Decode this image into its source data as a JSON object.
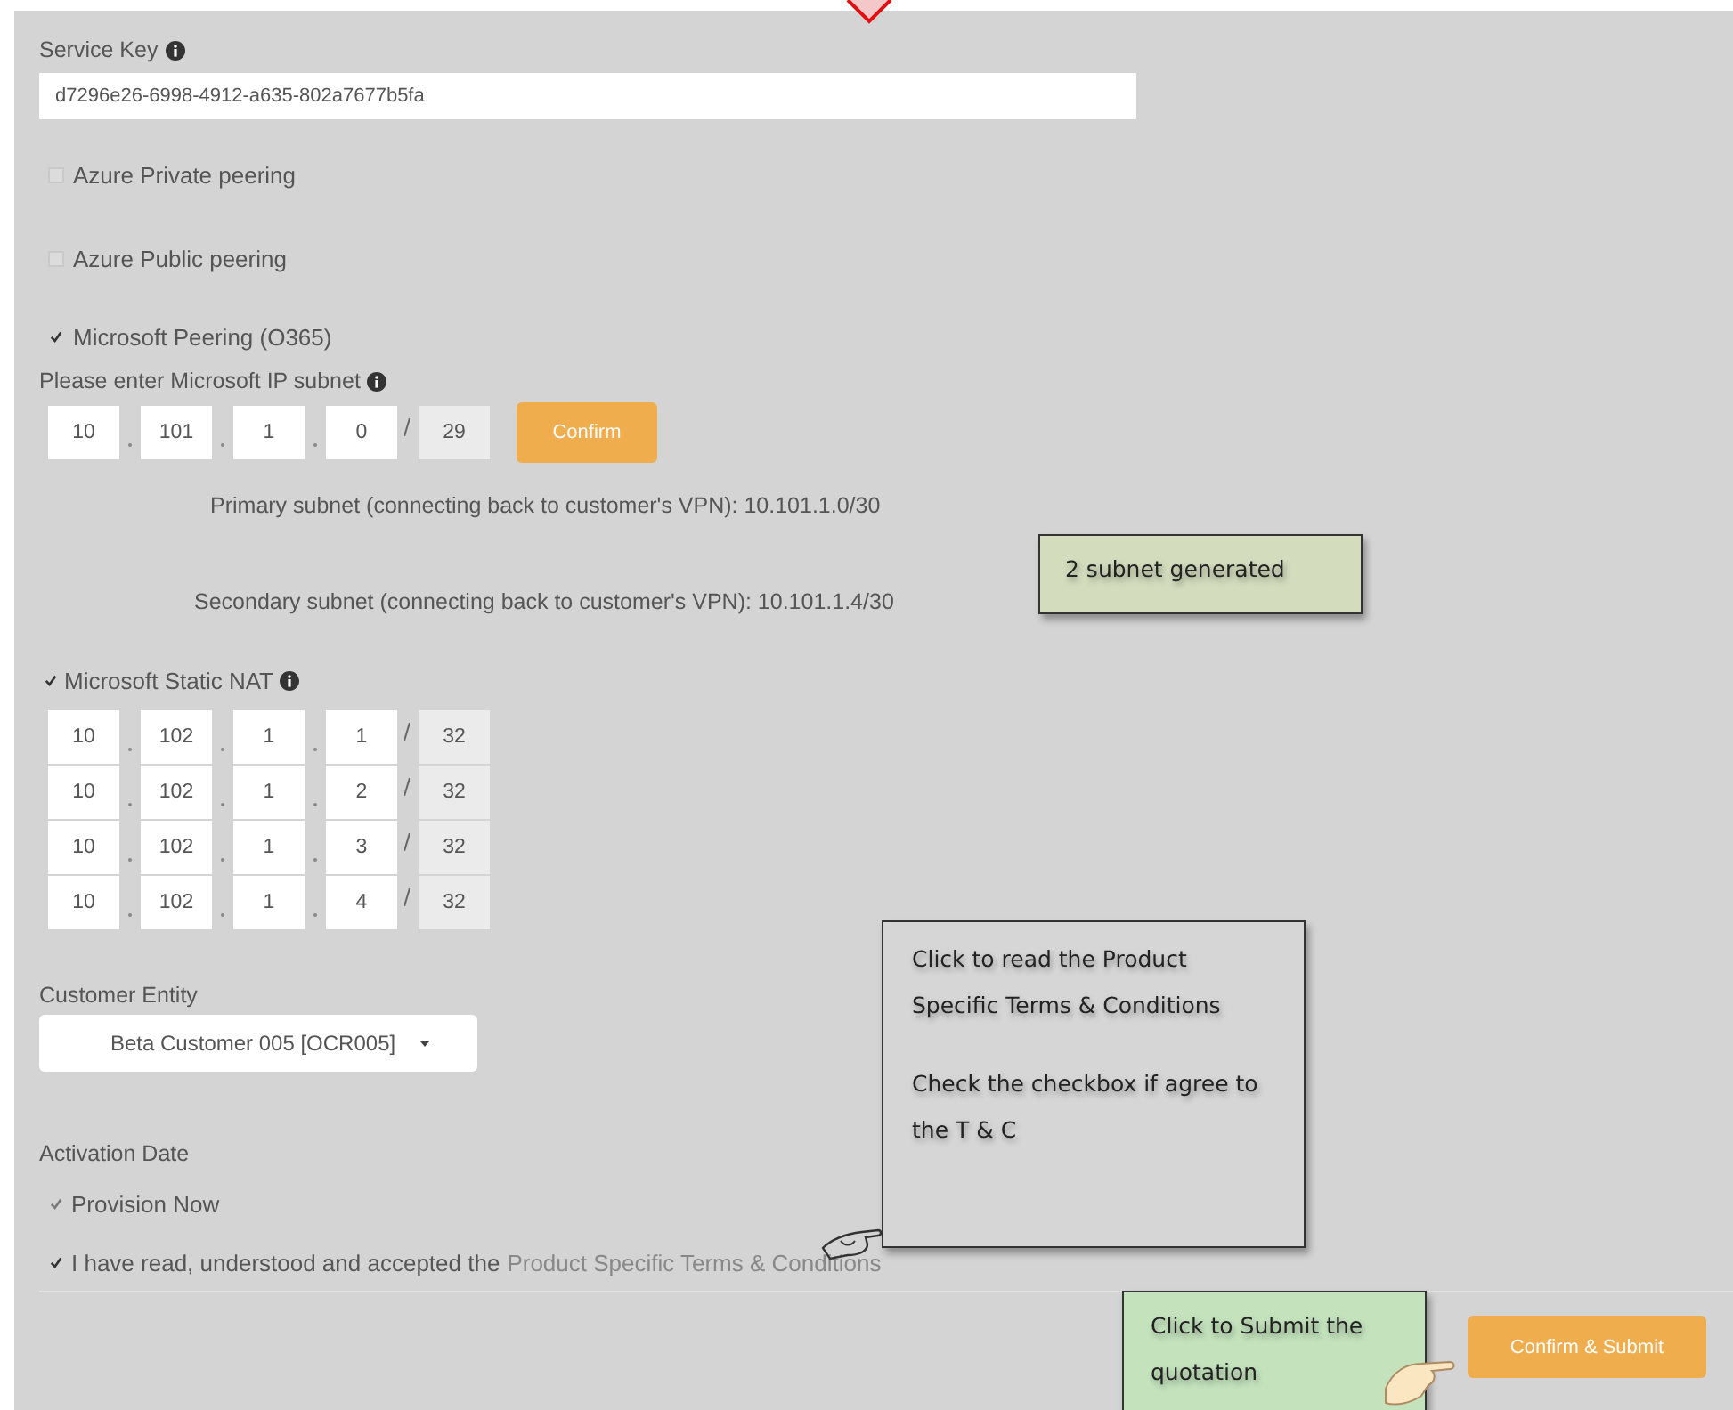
{
  "service_key": {
    "label": "Service Key",
    "value": "d7296e26-6998-4912-a635-802a7677b5fa"
  },
  "peering_options": [
    {
      "label": "Azure Private peering",
      "checked": false
    },
    {
      "label": "Azure Public peering",
      "checked": false
    },
    {
      "label": "Microsoft Peering (O365)",
      "checked": true
    }
  ],
  "subnet": {
    "label": "Please enter Microsoft IP subnet",
    "octets": [
      "10",
      "101",
      "1",
      "0"
    ],
    "prefix": "29",
    "confirm_button": "Confirm"
  },
  "generated_subnets": [
    "Primary subnet (connecting back to customer's VPN): 10.101.1.0/30",
    "Secondary subnet (connecting back to customer's VPN): 10.101.1.4/30"
  ],
  "static_nat": {
    "label": "Microsoft Static NAT",
    "checked": true,
    "rows": [
      {
        "octets": [
          "10",
          "102",
          "1",
          "1"
        ],
        "prefix": "32"
      },
      {
        "octets": [
          "10",
          "102",
          "1",
          "2"
        ],
        "prefix": "32"
      },
      {
        "octets": [
          "10",
          "102",
          "1",
          "3"
        ],
        "prefix": "32"
      },
      {
        "octets": [
          "10",
          "102",
          "1",
          "4"
        ],
        "prefix": "32"
      }
    ]
  },
  "customer_entity": {
    "label": "Customer Entity",
    "value": "Beta Customer 005 [OCR005]"
  },
  "activation": {
    "label": "Activation Date",
    "option": {
      "label": "Provision Now",
      "checked": true
    }
  },
  "terms": {
    "checked": true,
    "text": "I have read, understood and accepted the",
    "link": "Product Specific Terms & Conditions"
  },
  "submit_button": "Confirm & Submit",
  "annotations": [
    {
      "kind": "subnets",
      "color": "#d3dcbd",
      "paragraphs": [
        "2 subnet generated"
      ]
    },
    {
      "kind": "terms",
      "color": "#d6d6d6",
      "paragraphs": [
        "Click to read the Product Specific Terms & Conditions",
        "Check the checkbox if agree to the T & C"
      ]
    },
    {
      "kind": "submit",
      "color": "#c4e3bd",
      "paragraphs": [
        "Click to Submit the quotation"
      ]
    }
  ]
}
